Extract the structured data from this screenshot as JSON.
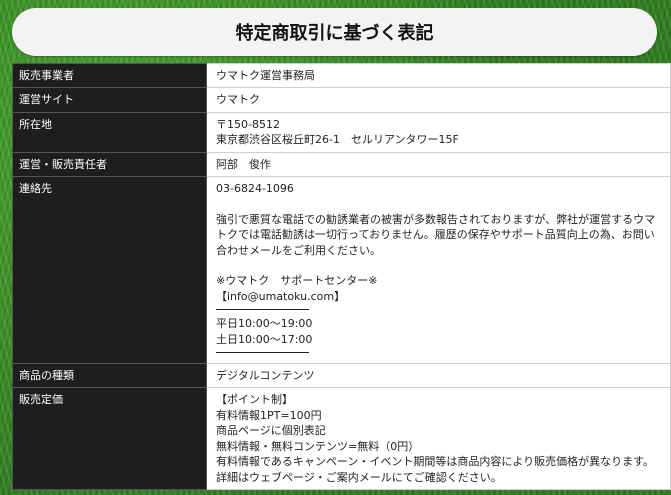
{
  "page": {
    "title": "特定商取引に基づく表記"
  },
  "rows": [
    {
      "label": "販売事業者",
      "lines": [
        "ウマトク運営事務局"
      ]
    },
    {
      "label": "運営サイト",
      "lines": [
        "ウマトク"
      ]
    },
    {
      "label": "所在地",
      "lines": [
        "〒150-8512",
        "東京都渋谷区桜丘町26-1　セルリアンタワー15F"
      ]
    },
    {
      "label": "運営・販売責任者",
      "lines": [
        "阿部　俊作"
      ]
    }
  ],
  "contact": {
    "label": "連絡先",
    "phone": "03-6824-1096",
    "notice": "強引で悪質な電話での勧誘業者の被害が多数報告されておりますが、弊社が運営するウマトクでは電話勧誘は一切行っておりません。履歴の保存やサポート品質向上の為、お問い合わせメールをご利用ください。",
    "support_center": "※ウマトク　サポートセンター※",
    "email": "【info@umatoku.com】",
    "weekday_hours": "平日10:00～19:00",
    "saturday_hours": "土日10:00～17:00"
  },
  "product_type": {
    "label": "商品の種類",
    "value": "デジタルコンテンツ"
  },
  "pricing": {
    "label": "販売定価",
    "lines": [
      "【ポイント制】",
      "有料情報1PT=100円",
      "商品ページに個別表記",
      "無料情報・無料コンテンツ=無料（0円）"
    ],
    "note": "有料情報であるキャンペーン・イベント期間等は商品内容により販売価格が異なります。詳細はウェブページ・ご案内メールにてご確認ください。"
  }
}
